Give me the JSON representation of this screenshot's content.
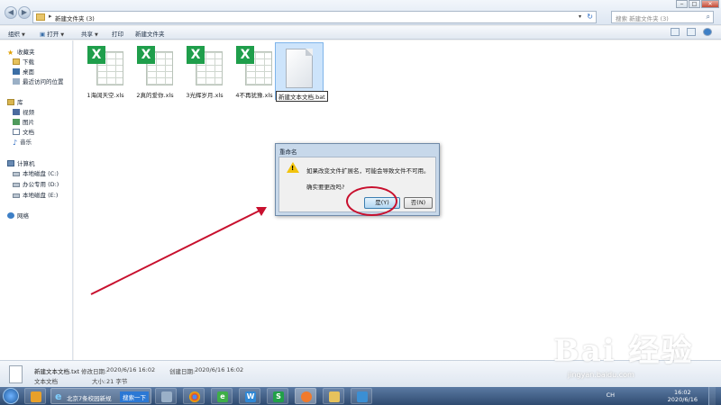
{
  "address": {
    "path": "新建文件夹 (3)",
    "search_placeholder": "搜索 新建文件夹 (3)"
  },
  "toolbar": {
    "organize": "组织",
    "open": "打开",
    "share": "共享",
    "print": "打印",
    "new_folder": "新建文件夹"
  },
  "nav": {
    "favorites": "收藏夹",
    "favorites_items": [
      "下载",
      "桌面",
      "最近访问的位置"
    ],
    "libraries": "库",
    "library_items": [
      "视频",
      "图片",
      "文档",
      "音乐"
    ],
    "computer": "计算机",
    "drives": [
      "本地磁盘 (C:)",
      "办公专用 (D:)",
      "本地磁盘 (E:)"
    ],
    "network": "网络"
  },
  "files": [
    {
      "name": "1海阔天空.xls",
      "type": "xls"
    },
    {
      "name": "2真的爱你.xls",
      "type": "xls"
    },
    {
      "name": "3光辉岁月.xls",
      "type": "xls"
    },
    {
      "name": "4不再犹豫.xls",
      "type": "xls"
    },
    {
      "name": "新建文本文档.bat",
      "type": "bat",
      "renaming": true
    }
  ],
  "dialog": {
    "title": "重命名",
    "message": "如果改变文件扩展名，可能会导致文件不可用。",
    "question": "确实要更改吗?",
    "yes": "是(Y)",
    "no": "否(N)"
  },
  "details": {
    "name": "新建文本文档.txt",
    "type": "文本文档",
    "modified_label": "修改日期:",
    "modified": "2020/6/16 16:02",
    "created_label": "创建日期:",
    "created": "2020/6/16 16:02",
    "size_label": "大小:",
    "size": "21 字节"
  },
  "taskbar": {
    "ie_title": "北京7条校园新规",
    "search_button": "搜索一下",
    "time": "16:02",
    "date": "2020/6/16",
    "lang": "CH"
  },
  "watermark": {
    "logo": "Bai 经验",
    "url": "jingyan.baidu.com"
  },
  "colors": {
    "xls_green": "#1f9e4b",
    "annotation_red": "#c8102e",
    "selection": "#cde4fb"
  }
}
